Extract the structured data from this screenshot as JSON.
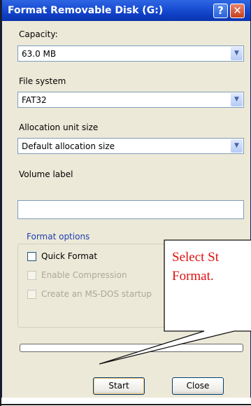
{
  "window": {
    "title": "Format Removable Disk (G:)",
    "help_glyph": "?",
    "close_glyph": "✕"
  },
  "capacity": {
    "label": "Capacity:",
    "value": "63.0 MB"
  },
  "file_system": {
    "label": "File system",
    "value": "FAT32"
  },
  "allocation": {
    "label": "Allocation unit size",
    "value": "Default allocation size"
  },
  "volume": {
    "label": "Volume label",
    "value": ""
  },
  "format_options": {
    "title": "Format options",
    "quick": "Quick Format",
    "compression": "Enable Compression",
    "msdos": "Create an MS-DOS startup"
  },
  "progress": {
    "fraction": 0
  },
  "buttons": {
    "start": "Start",
    "close": "Close"
  },
  "callout": {
    "line1": "Select St",
    "line2": "Format."
  },
  "icons": {
    "dropdown": "▼"
  },
  "colors": {
    "callout_text": "#e01010",
    "title_bar": "#1d52d6",
    "dialog_bg": "#ece9d8"
  }
}
